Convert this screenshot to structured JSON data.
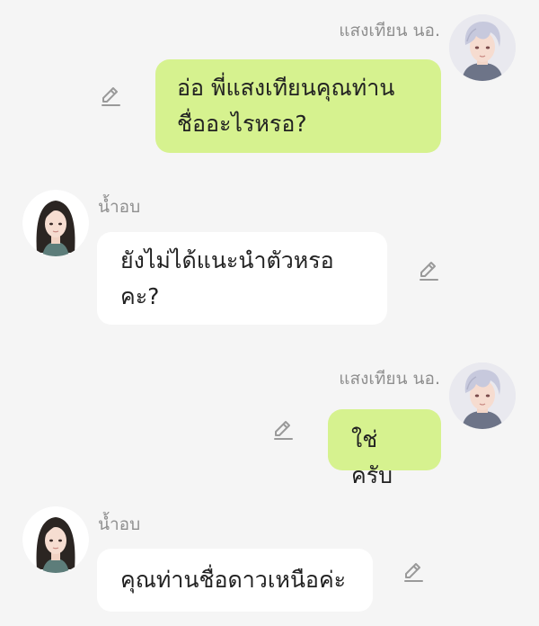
{
  "messages": [
    {
      "sender": "แสงเทียน นอ.",
      "side": "right",
      "lines": [
        "อ่อ พี่แสงเทียนคุณท่าน",
        "ชื่ออะไรหรอ?"
      ],
      "avatar_icon": "white-haired-boy-avatar",
      "edit_icon": "pencil-icon"
    },
    {
      "sender": "น้ำอบ",
      "side": "left",
      "lines": [
        "ยังไม่ได้แนะนำตัวหรอ",
        "คะ?"
      ],
      "avatar_icon": "dark-haired-girl-avatar",
      "edit_icon": "pencil-icon"
    },
    {
      "sender": "แสงเทียน นอ.",
      "side": "right",
      "lines": [
        "ใช่ครับ"
      ],
      "avatar_icon": "white-haired-boy-avatar",
      "edit_icon": "pencil-icon"
    },
    {
      "sender": "น้ำอบ",
      "side": "left",
      "lines": [
        "คุณท่านชื่อดาวเหนือค่ะ"
      ],
      "avatar_icon": "dark-haired-girl-avatar",
      "edit_icon": "pencil-icon"
    }
  ],
  "colors": {
    "background": "#f5f5f5",
    "my_bubble": "#d6f28f",
    "other_bubble": "#ffffff",
    "sender_name": "#8f8f8f",
    "icon": "#9a9a9a"
  }
}
